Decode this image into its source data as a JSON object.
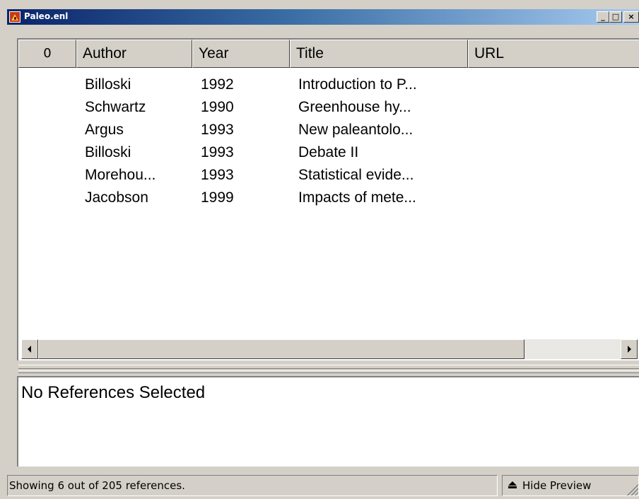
{
  "window": {
    "title": "Paleo.enl",
    "controls": {
      "minimize": "_",
      "maximize": "□",
      "close": "×"
    }
  },
  "list": {
    "columns": [
      "Author",
      "Year",
      "Title",
      "URL"
    ],
    "attachment_column_icon": "paperclip-icon",
    "attachment_glyph": "0",
    "rows": [
      {
        "author": "Billoski",
        "year": "1992",
        "title": "Introduction to P..."
      },
      {
        "author": "Schwartz",
        "year": "1990",
        "title": "Greenhouse hy..."
      },
      {
        "author": "Argus",
        "year": "1993",
        "title": "New paleantolo..."
      },
      {
        "author": "Billoski",
        "year": "1993",
        "title": "Debate II"
      },
      {
        "author": "Morehou...",
        "year": "1993",
        "title": "Statistical evide..."
      },
      {
        "author": "Jacobson",
        "year": "1999",
        "title": "Impacts of mete..."
      }
    ]
  },
  "preview": {
    "text": "No References Selected"
  },
  "status": {
    "text": "Showing 6 out of 205 references.",
    "hide_preview_label": "Hide Preview",
    "hide_preview_icon": "eject-icon"
  },
  "colors": {
    "titlebar_start": "#0a246a",
    "titlebar_end": "#a6caf0",
    "face": "#d4d0c8"
  }
}
